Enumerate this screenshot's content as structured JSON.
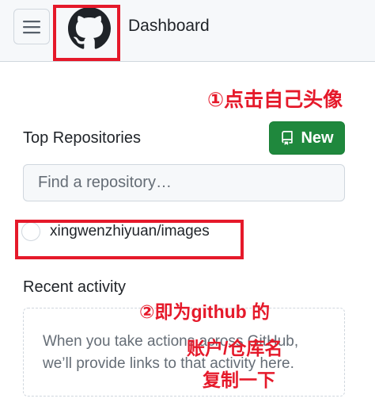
{
  "header": {
    "menu_icon": "hamburger-icon",
    "logo_icon": "github-logo-icon",
    "title": "Dashboard"
  },
  "annotations": {
    "step1": "①点击自己头像",
    "step2_line1": "②即为github 的",
    "step2_line2": "账户/仓库名",
    "step2_line3": "复制一下",
    "color": "#e5192a"
  },
  "top_repositories": {
    "heading": "Top Repositories",
    "new_button_label": "New",
    "new_button_icon": "repo-icon",
    "search_placeholder": "Find a repository…",
    "repos": [
      {
        "name": "xingwenzhiyuan/images"
      }
    ]
  },
  "recent_activity": {
    "heading": "Recent activity",
    "empty_message": "When you take actions across GitHub, we’ll provide links to that activity here."
  },
  "colors": {
    "primary_button": "#1f883d",
    "header_bg": "#f6f8fa",
    "border": "#d0d7de"
  }
}
